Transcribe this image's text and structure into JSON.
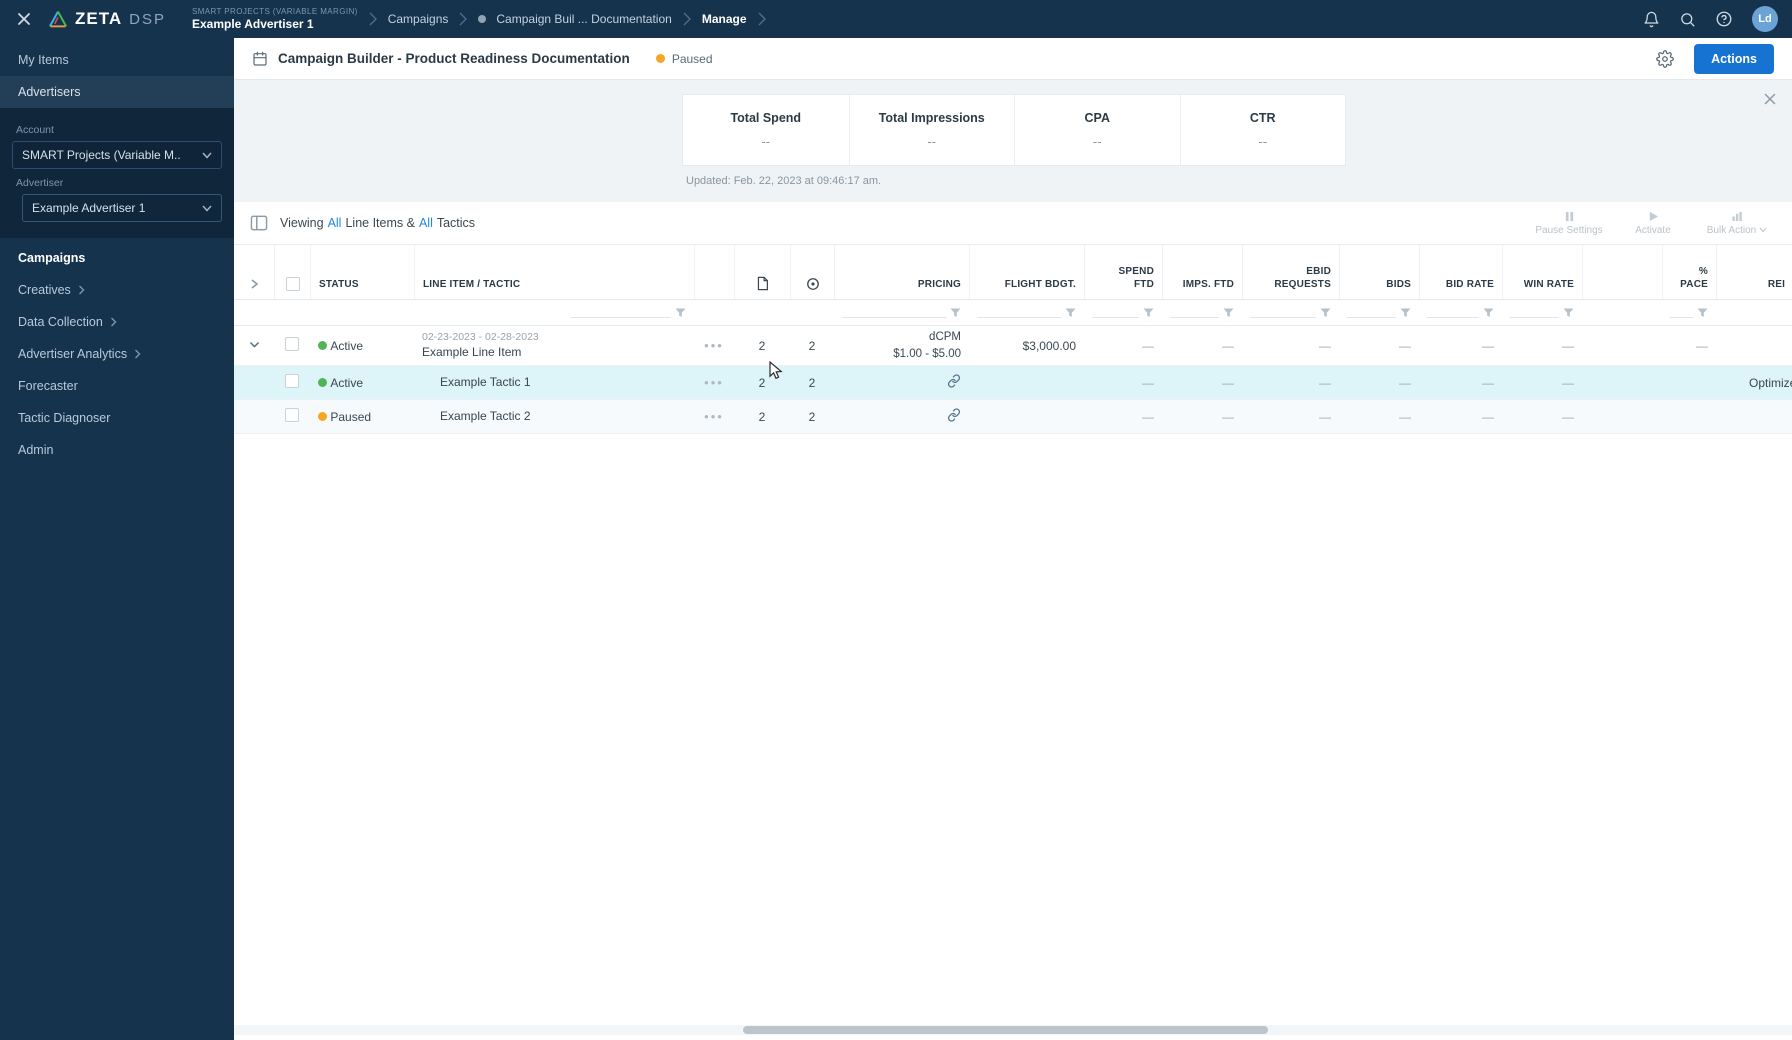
{
  "colors": {
    "accent": "#1673d2",
    "active_green": "#52b357",
    "paused_orange": "#f5a623",
    "row_highlight": "#ddf4f8"
  },
  "topbar": {
    "logo_zeta": "ZETA",
    "logo_dsp": "DSP",
    "crumb_account": "SMART PROJECTS (VARIABLE MARGIN)",
    "crumb_advertiser": "Example Advertiser 1",
    "crumb_campaigns": "Campaigns",
    "crumb_campaign": "Campaign Buil ... Documentation",
    "crumb_manage": "Manage",
    "avatar_initials": "Ld"
  },
  "sidebar": {
    "my_items": "My Items",
    "advertisers": "Advertisers",
    "account_label": "Account",
    "account_value": "SMART Projects (Variable M..",
    "advertiser_label": "Advertiser",
    "advertiser_value": "Example Advertiser 1",
    "nav": [
      "Campaigns",
      "Creatives",
      "Data Collection",
      "Advertiser Analytics",
      "Forecaster",
      "Tactic Diagnoser",
      "Admin"
    ]
  },
  "page": {
    "title": "Campaign Builder - Product Readiness Documentation",
    "status": "Paused",
    "actions_button": "Actions"
  },
  "stats": {
    "items": [
      {
        "label": "Total Spend",
        "value": "--"
      },
      {
        "label": "Total Impressions",
        "value": "--"
      },
      {
        "label": "CPA",
        "value": "--"
      },
      {
        "label": "CTR",
        "value": "--"
      }
    ],
    "updated": "Updated: Feb. 22, 2023 at 09:46:17 am."
  },
  "toolbar": {
    "viewing_prefix": "Viewing",
    "all_a": "All",
    "mid": "Line Items &",
    "all_b": "All",
    "suffix": "Tactics",
    "pause_settings": "Pause Settings",
    "activate": "Activate",
    "bulk_action": "Bulk Action"
  },
  "table": {
    "headers": {
      "status": "STATUS",
      "line_item": "LINE ITEM / TACTIC",
      "pricing": "PRICING",
      "flight": "FLIGHT BDGT.",
      "spend1": "SPEND",
      "spend2": "FTD",
      "imps": "IMPS. FTD",
      "ebid1": "EBID",
      "ebid2": "REQUESTS",
      "bids": "BIDS",
      "bid_rate": "BID RATE",
      "win_rate": "WIN RATE",
      "pace": "% PACE",
      "rei": "REI"
    },
    "rows": [
      {
        "status": "Active",
        "dates": "02-23-2023 - 02-28-2023",
        "name": "Example Line Item",
        "creatives": "2",
        "targets": "2",
        "pricing1": "dCPM",
        "pricing2": "$1.00 - $5.00",
        "flight": "$3,000.00",
        "spend": "—",
        "imps": "—",
        "ebid": "—",
        "bids": "—",
        "bid_rate": "—",
        "win_rate": "—",
        "pace": "—",
        "rei": ""
      },
      {
        "status": "Active",
        "name": "Example Tactic 1",
        "creatives": "2",
        "targets": "2",
        "flight": "",
        "spend": "—",
        "imps": "—",
        "ebid": "—",
        "bids": "—",
        "bid_rate": "—",
        "win_rate": "—",
        "pace": "",
        "rei": "Optimized"
      },
      {
        "status": "Paused",
        "name": "Example Tactic 2",
        "creatives": "2",
        "targets": "2",
        "flight": "",
        "spend": "—",
        "imps": "—",
        "ebid": "—",
        "bids": "—",
        "bid_rate": "—",
        "win_rate": "—",
        "pace": "",
        "rei": ""
      }
    ]
  }
}
